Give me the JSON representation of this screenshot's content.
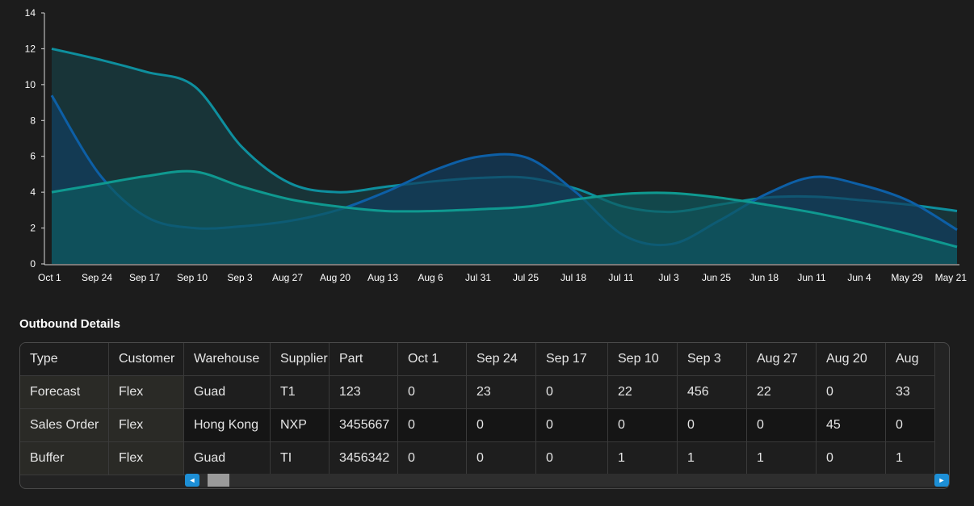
{
  "chart_data": {
    "type": "area",
    "categories": [
      "Oct 1",
      "Sep 24",
      "Sep 17",
      "Sep 10",
      "Sep 3",
      "Aug 27",
      "Aug 20",
      "Aug 13",
      "Aug 6",
      "Jul 31",
      "Jul 25",
      "Jul 18",
      "Jul 11",
      "Jul 3",
      "Jun 25",
      "Jun 18",
      "Jun 11",
      "Jun 4",
      "May 29",
      "May 21"
    ],
    "ylim": [
      0,
      14
    ],
    "yticks": [
      0,
      2,
      4,
      6,
      8,
      10,
      12,
      14
    ],
    "series": [
      {
        "values": [
          12,
          11.4,
          10.7,
          9.9,
          6.5,
          4.5,
          4.0,
          4.3,
          4.6,
          4.8,
          4.8,
          4.2,
          3.2,
          2.9,
          3.3,
          3.7,
          3.75,
          3.55,
          3.3,
          2.95
        ],
        "color": "#0e8f9e",
        "fill": "#173f45"
      },
      {
        "values": [
          9.4,
          5.0,
          2.6,
          2.0,
          2.1,
          2.4,
          3.0,
          4.0,
          5.2,
          6.0,
          5.9,
          4.0,
          1.6,
          1.1,
          2.4,
          3.9,
          4.85,
          4.4,
          3.5,
          1.9
        ],
        "color": "#0d5fa6",
        "fill": "#113d60"
      },
      {
        "values": [
          4.0,
          4.45,
          4.9,
          5.15,
          4.3,
          3.6,
          3.2,
          2.95,
          2.95,
          3.05,
          3.2,
          3.6,
          3.9,
          3.95,
          3.7,
          3.3,
          2.85,
          2.3,
          1.65,
          0.95
        ],
        "color": "#0f9990",
        "fill": "#0e5a60"
      }
    ]
  },
  "section_title": "Outbound Details",
  "table": {
    "columns": [
      "Type",
      "Customer",
      "Warehouse",
      "Supplier",
      "Part",
      "Oct 1",
      "Sep 24",
      "Sep 17",
      "Sep 10",
      "Sep 3",
      "Aug 27",
      "Aug 20",
      "Aug"
    ],
    "rows": [
      [
        "Forecast",
        "Flex",
        "Guad",
        "T1",
        "123",
        "0",
        "23",
        "0",
        "22",
        "456",
        "22",
        "0",
        "33"
      ],
      [
        "Sales Order",
        "Flex",
        "Hong Kong",
        "NXP",
        "3455667",
        "0",
        "0",
        "0",
        "0",
        "0",
        "0",
        "45",
        "0"
      ],
      [
        "Buffer",
        "Flex",
        "Guad",
        "TI",
        "3456342",
        "0",
        "0",
        "0",
        "1",
        "1",
        "1",
        "0",
        "1"
      ]
    ]
  },
  "scrollbar": {
    "left_arrow": "◄",
    "right_arrow": "►"
  }
}
